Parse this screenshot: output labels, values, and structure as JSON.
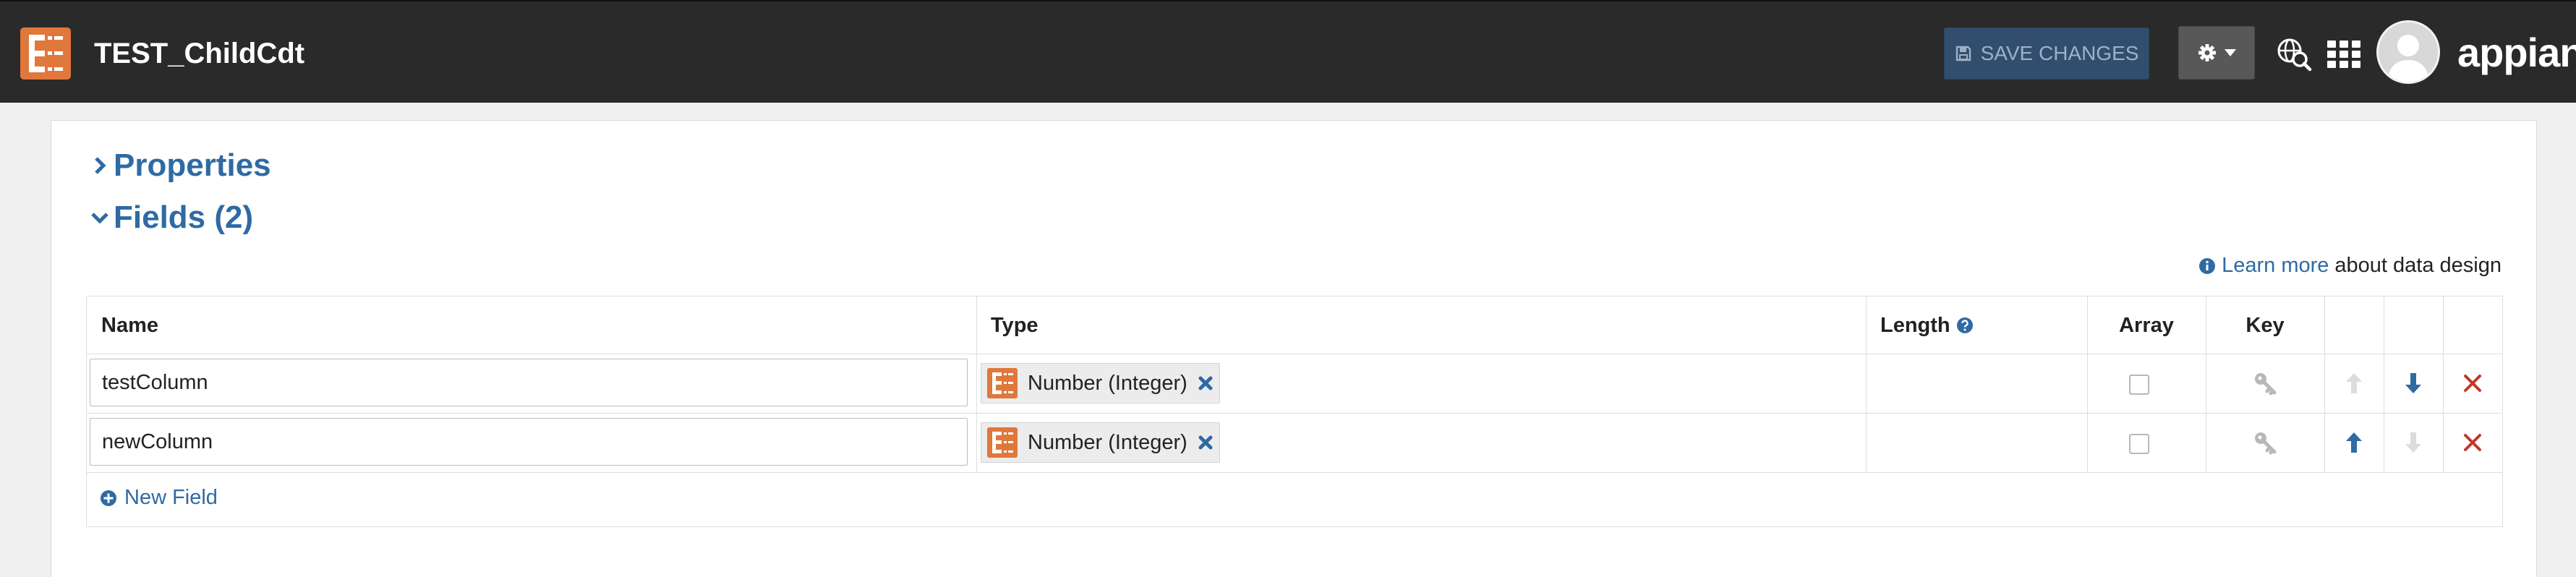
{
  "header": {
    "title": "TEST_ChildCdt",
    "save_label": "SAVE CHANGES",
    "brand": "appian"
  },
  "sections": {
    "properties": "Properties",
    "fields": "Fields (2)"
  },
  "help": {
    "link": "Learn more",
    "text": "about data design"
  },
  "table": {
    "columns": {
      "name": "Name",
      "type": "Type",
      "length": "Length",
      "array": "Array",
      "key": "Key"
    },
    "rows": [
      {
        "name": "testColumn",
        "type": "Number (Integer)",
        "array": false,
        "move_up_enabled": false,
        "move_down_enabled": true
      },
      {
        "name": "newColumn",
        "type": "Number (Integer)",
        "array": false,
        "move_up_enabled": true,
        "move_down_enabled": false
      }
    ],
    "new_field_label": "New Field"
  },
  "colors": {
    "topbar": "#2a2a2a",
    "accent": "#2f6aa3",
    "logo": "#e0773b",
    "delete": "#c0392b",
    "save_button": "#324e6e"
  },
  "icons": [
    "app-logo-icon",
    "floppy-disk-icon",
    "gear-icon",
    "caret-down-icon",
    "globe-search-icon",
    "app-grid-icon",
    "avatar",
    "info-icon",
    "help-circle-icon",
    "key-icon",
    "arrow-up-icon",
    "arrow-down-icon",
    "delete-x-icon",
    "plus-circle-icon"
  ]
}
